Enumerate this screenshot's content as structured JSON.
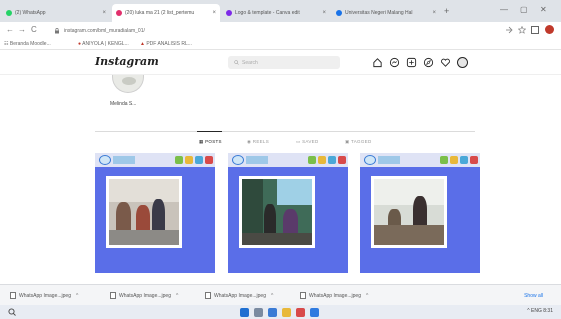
{
  "browser": {
    "tabs": [
      {
        "label": "(2) WhatsApp",
        "active": false,
        "favicon_color": "#25d366"
      },
      {
        "label": "(20) luka ma 21 (2 list_pertemu",
        "active": true,
        "favicon_color": "#e1306c"
      },
      {
        "label": "Logo & template - Canva edit",
        "active": false,
        "favicon_color": "#7d2ae8"
      },
      {
        "label": "Universitas Negeri Malang Hal",
        "active": false,
        "favicon_color": "#1a73e8"
      }
    ],
    "tab_close_glyph": "×",
    "new_tab_glyph": "+",
    "window_controls": [
      "—",
      "▢",
      "✕"
    ],
    "nav": {
      "back": "←",
      "forward": "→",
      "reload": "C"
    },
    "address": "instagram.com/bml_muradialam_01/",
    "bookmarks": [
      "Beranda Moodle...",
      "ANIYOLA | KENGL...",
      "PDF ANALISIS RL..."
    ]
  },
  "instagram": {
    "logo": "Instagram",
    "search_placeholder": "Search",
    "header_icons": [
      "home-icon",
      "messenger-icon",
      "new-post-icon",
      "explore-icon",
      "heart-icon",
      "profile-avatar-icon"
    ],
    "username": "Melinda S...",
    "profile_tabs": [
      {
        "label": "POSTS",
        "active": true
      },
      {
        "label": "REELS",
        "active": false
      },
      {
        "label": "SAVED",
        "active": false
      },
      {
        "label": "TAGGED",
        "active": false
      }
    ],
    "posts": [
      {
        "name": "post-1",
        "scene": "classroom-group"
      },
      {
        "name": "post-2",
        "scene": "teacher-at-screen"
      },
      {
        "name": "post-3",
        "scene": "students-at-desk"
      }
    ],
    "accent": "#5a6ee8"
  },
  "downloads": {
    "items": [
      "WhatsApp Image...jpeg",
      "WhatsApp Image...jpeg",
      "WhatsApp Image...jpeg",
      "WhatsApp Image...jpeg"
    ],
    "show_all": "Show all",
    "caret": "^"
  },
  "taskbar": {
    "tray_text": "^ ENG 8:31"
  }
}
